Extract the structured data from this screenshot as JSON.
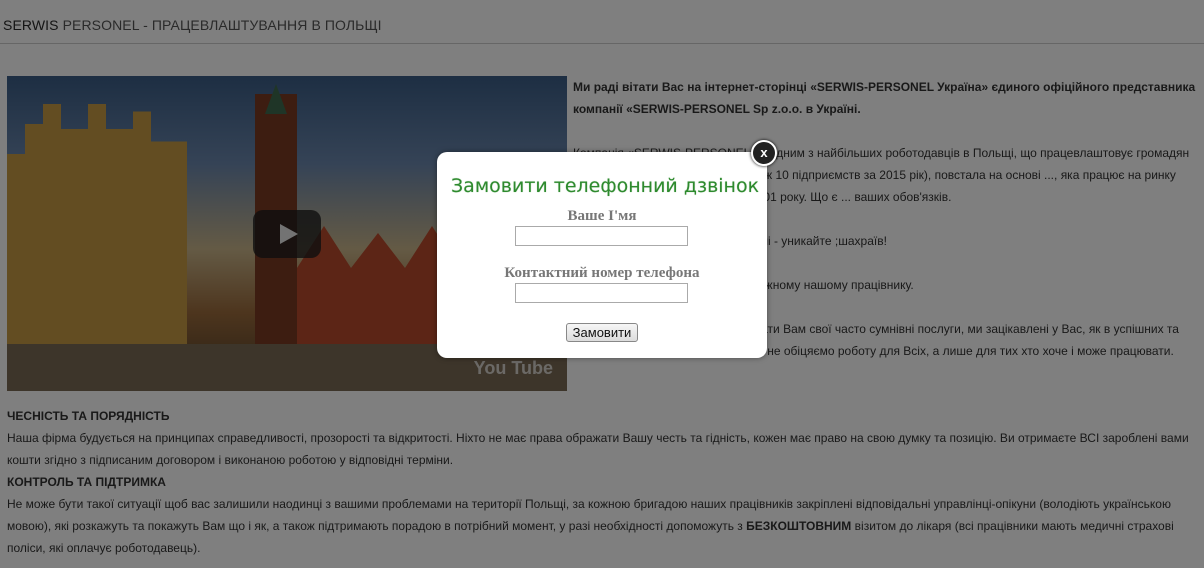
{
  "header": {
    "title_brand": "SERWIS",
    "title_rest": " PERSONEL - ПРАЦЕВЛАШТУВАННЯ В ПОЛЬЩІ"
  },
  "video": {
    "logo_text": "You Tube",
    "play_icon": "play-icon"
  },
  "content": {
    "intro": "Ми раді вітати Вас на інтернет-сторінці «SERWIS-PERSONEL Україна» єдиного офіційного представника компанії «SERWIS-PERSONEL Sp z.o.o. в Україні.",
    "p1": "Компанія «SERWIS-PERSONEL» є одним з найбільших роботодавців в Польщі, що працевлаштовує громадян України, ... працівників до більш ніж 10 підприємств за 2015 рік), повстала на основі ..., яка працює на ринку праці та дорадництва Польщі з 2001 року. Що є ... ваших обов'язків.",
    "p2": "... відомо які послуги, будьте пильні - уникайте ;шахраїв!",
    "p3": "..., а значить і соціальні гарантії кожному нашому працівнику.",
    "p4": "... які готові будь-якою ціною продати Вам свої часто сумнівні послуги, ми зацікавлені у Вас, як в успішних та результативних працівниках. Тому не обіцяємо роботу для Всіх, а лише для тих хто хоче і може працювати.",
    "h1": "ЧЕСНІСТЬ ТА ПОРЯДНІСТЬ",
    "b1": "Наша фірма будується на принципах справедливості, прозорості та відкритості. Ніхто не має права ображати Вашу честь та гідність, кожен має право на свою думку та позицію. Ви отримаєте ВСІ зароблені вами кошти згідно з підписаним договором і виконаною роботою у відповідні терміни.",
    "h2": "КОНТРОЛЬ ТА ПІДТРИМКА",
    "b2_start": "Не може бути такої ситуації щоб вас залишили наодинці з вашими проблемами на території Польщі, за кожною бригадою наших працівників закріплені відповідальні управлінці-опікуни (володіють українською мовою), які розкажуть та покажуть Вам що і як, а також підтримають порадою в потрібний момент, у разі необхідності допоможуть з ",
    "b2_bold": "БЕЗКОШТОВНИМ",
    "b2_end": " візитом до лікаря (всі працівники мають медичні страхові поліси, які оплачує роботодавець)."
  },
  "modal": {
    "close_label": "x",
    "title": "Замовити телефонний дзвінок",
    "name_label": "Ваше І'мя",
    "name_value": "",
    "phone_label": "Контактний номер телефона",
    "phone_value": "",
    "submit_label": "Замовити"
  }
}
